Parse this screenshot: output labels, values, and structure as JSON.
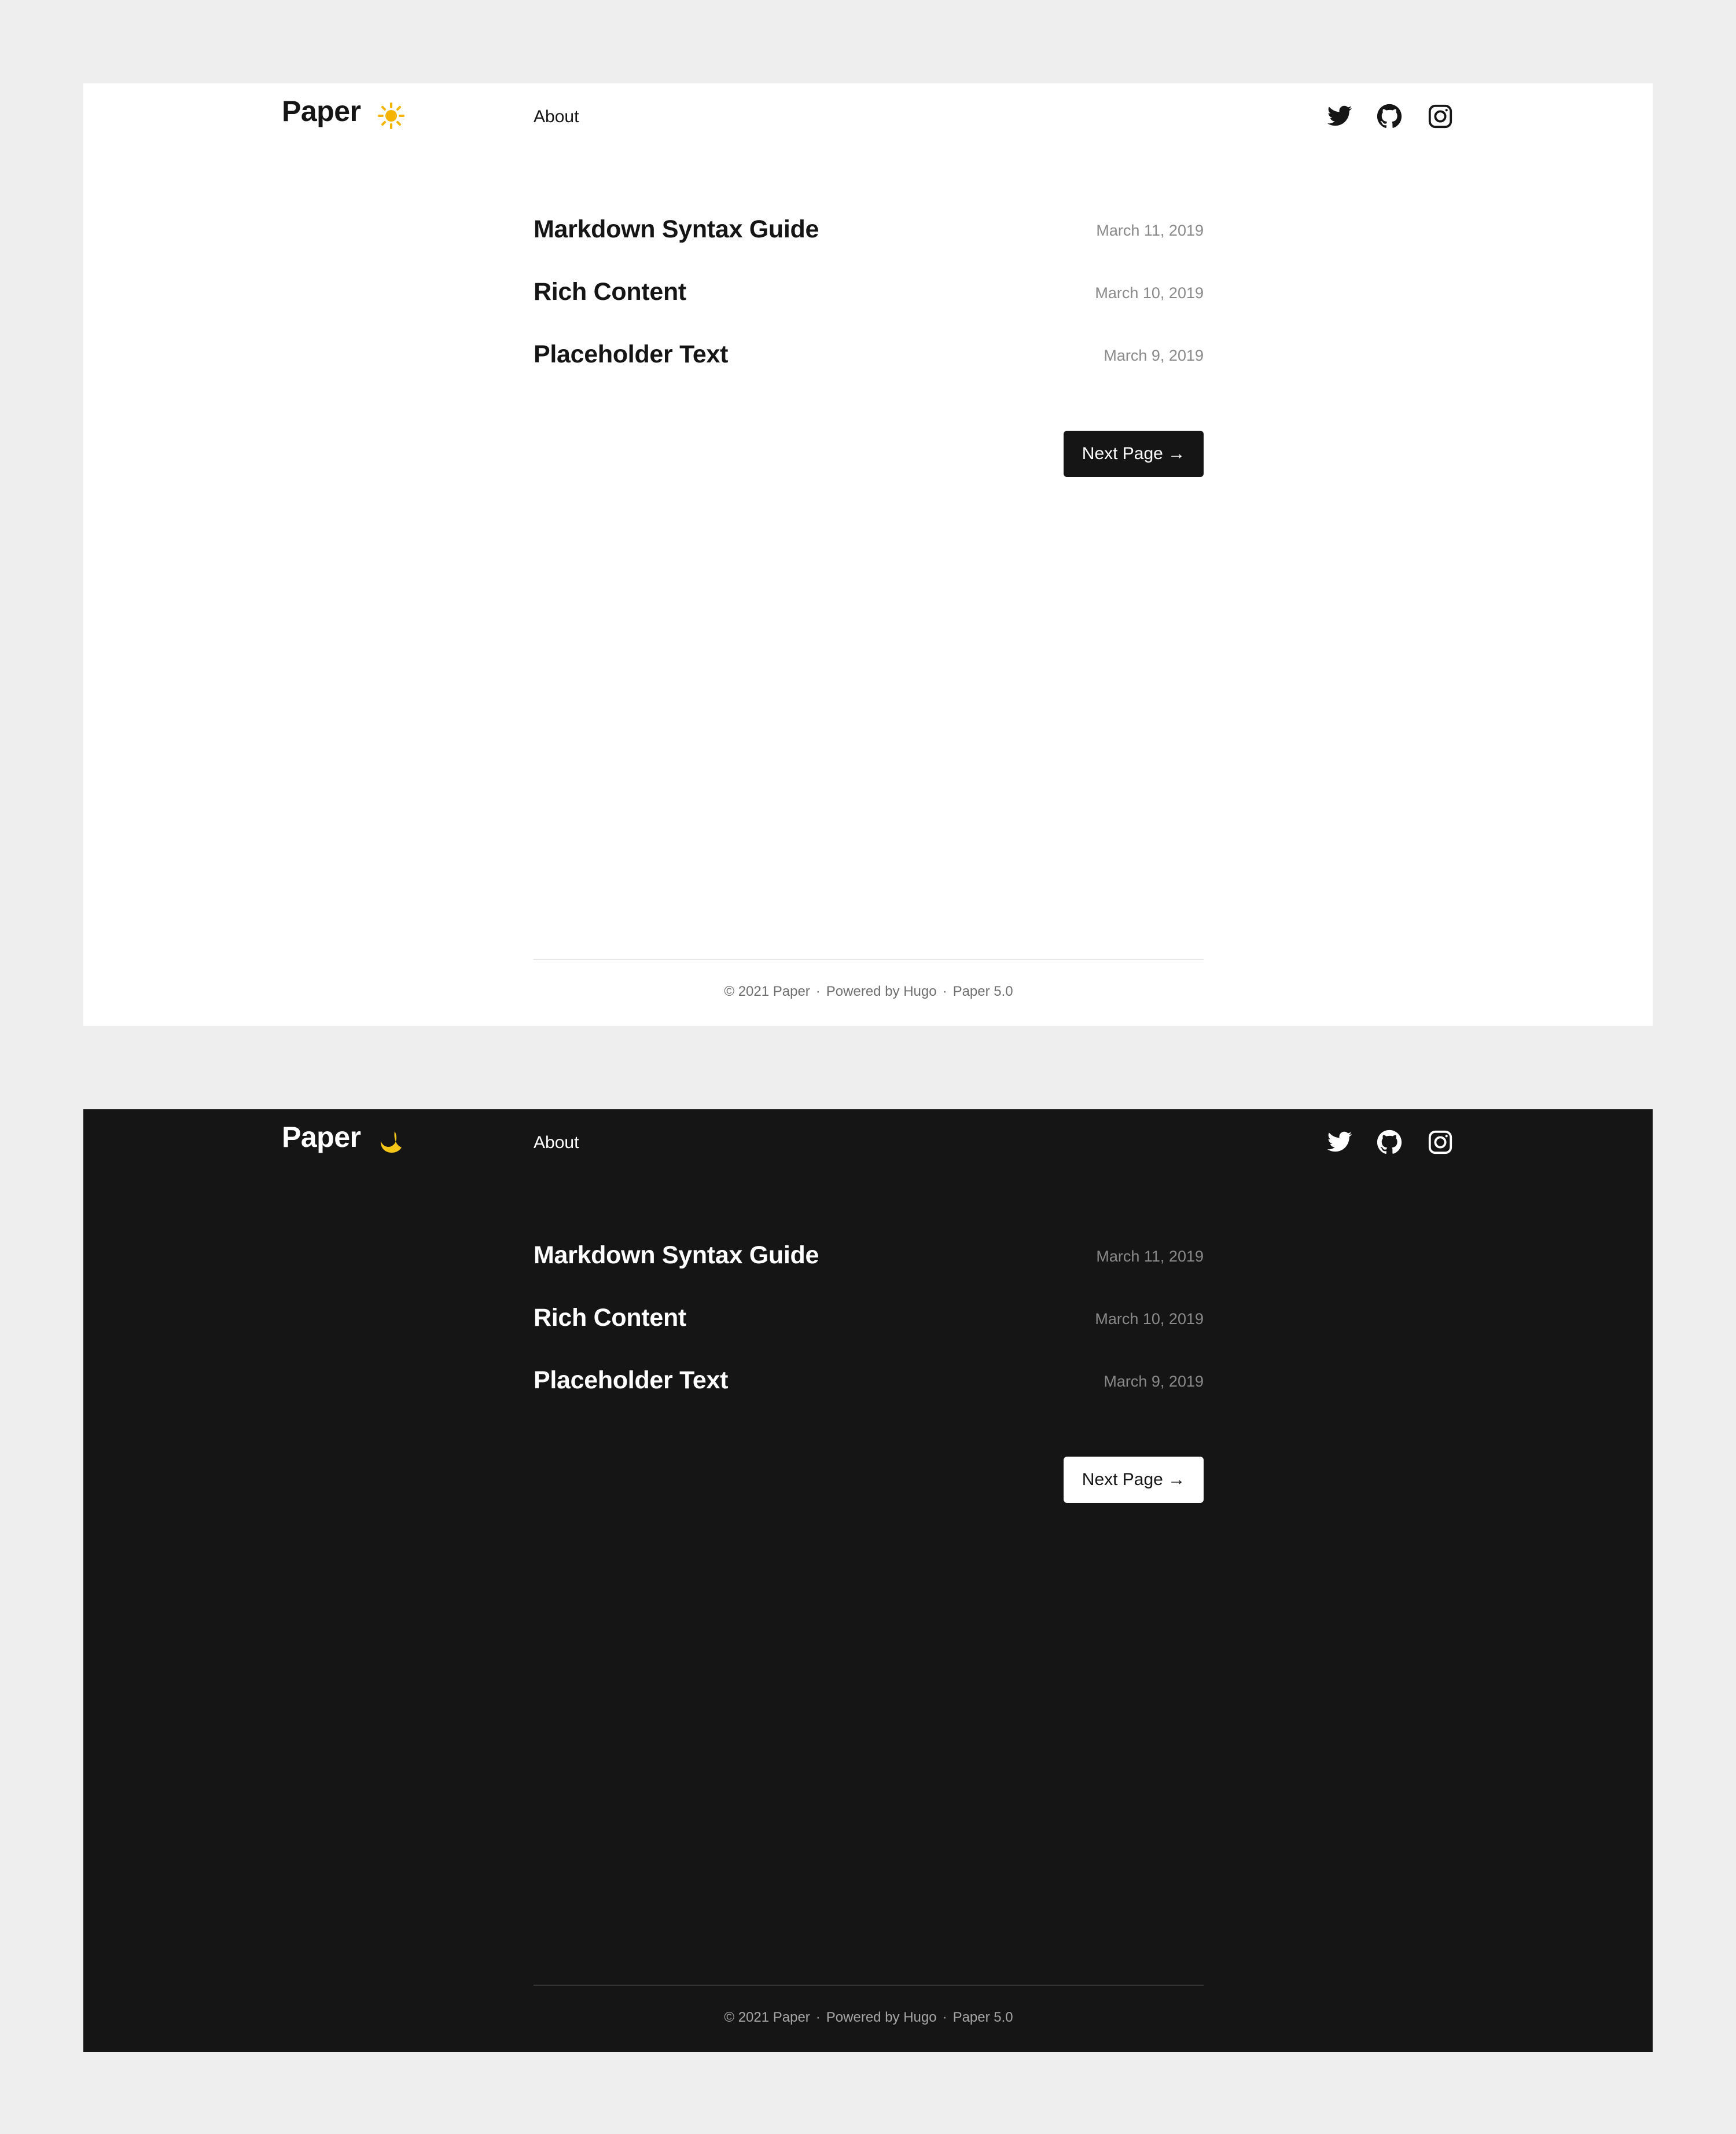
{
  "themes": [
    {
      "mode": "light",
      "logo": "Paper",
      "toggle_icon": "sun-icon",
      "nav": [
        {
          "label": "About"
        }
      ],
      "social": [
        "twitter-icon",
        "github-icon",
        "instagram-icon"
      ],
      "posts": [
        {
          "title": "Markdown Syntax Guide",
          "date": "March 11, 2019"
        },
        {
          "title": "Rich Content",
          "date": "March 10, 2019"
        },
        {
          "title": "Placeholder Text",
          "date": "March 9, 2019"
        }
      ],
      "next_page_label": "Next Page →",
      "footer": {
        "copyright": "© 2021 Paper",
        "powered": "Powered by Hugo",
        "version": "Paper 5.0",
        "separator": "·"
      }
    },
    {
      "mode": "dark",
      "logo": "Paper",
      "toggle_icon": "moon-icon",
      "nav": [
        {
          "label": "About"
        }
      ],
      "social": [
        "twitter-icon",
        "github-icon",
        "instagram-icon"
      ],
      "posts": [
        {
          "title": "Markdown Syntax Guide",
          "date": "March 11, 2019"
        },
        {
          "title": "Rich Content",
          "date": "March 10, 2019"
        },
        {
          "title": "Placeholder Text",
          "date": "March 9, 2019"
        }
      ],
      "next_page_label": "Next Page →",
      "footer": {
        "copyright": "© 2021 Paper",
        "powered": "Powered by Hugo",
        "version": "Paper 5.0",
        "separator": "·"
      }
    }
  ],
  "colors": {
    "page_background": "#eeeeee",
    "light_background": "#ffffff",
    "dark_background": "#151515",
    "light_text": "#151515",
    "dark_text": "#ffffff",
    "date_text": "#8a8a8a",
    "sun": "#f5b400",
    "moon": "#f5c518"
  }
}
